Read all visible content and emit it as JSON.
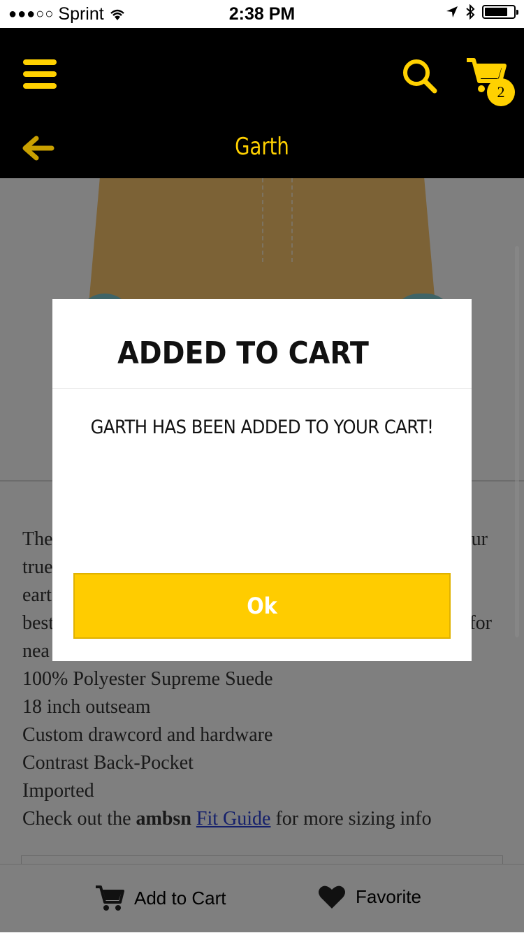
{
  "status_bar": {
    "signal": "●●●○○",
    "carrier": "Sprint",
    "time": "2:38 PM"
  },
  "header": {
    "title": "Garth",
    "cart_count": "2"
  },
  "description": {
    "visible_fragments": {
      "l1_left": "The",
      "l1_right": "ur",
      "l2_left": "true",
      "l3_left": "eart",
      "l4_left": "best",
      "l4_right": "for",
      "l5_left": "nea"
    },
    "specs": [
      "100% Polyester Supreme Suede",
      "18 inch outseam",
      "Custom drawcord and hardware",
      "Contrast Back-Pocket",
      "Imported"
    ],
    "fit_line": {
      "prefix": "Check out the",
      "brand": "ambsn",
      "link": "Fit Guide",
      "suffix": "for more sizing info"
    }
  },
  "bottom_bar": {
    "add_to_cart": "Add to Cart",
    "favorite": "Favorite"
  },
  "modal": {
    "title": "ADDED TO CART",
    "message": "GARTH HAS BEEN ADDED TO YOUR CART!",
    "ok_label": "Ok"
  },
  "colors": {
    "accent": "#ffcc00",
    "header_bg": "#000000"
  }
}
